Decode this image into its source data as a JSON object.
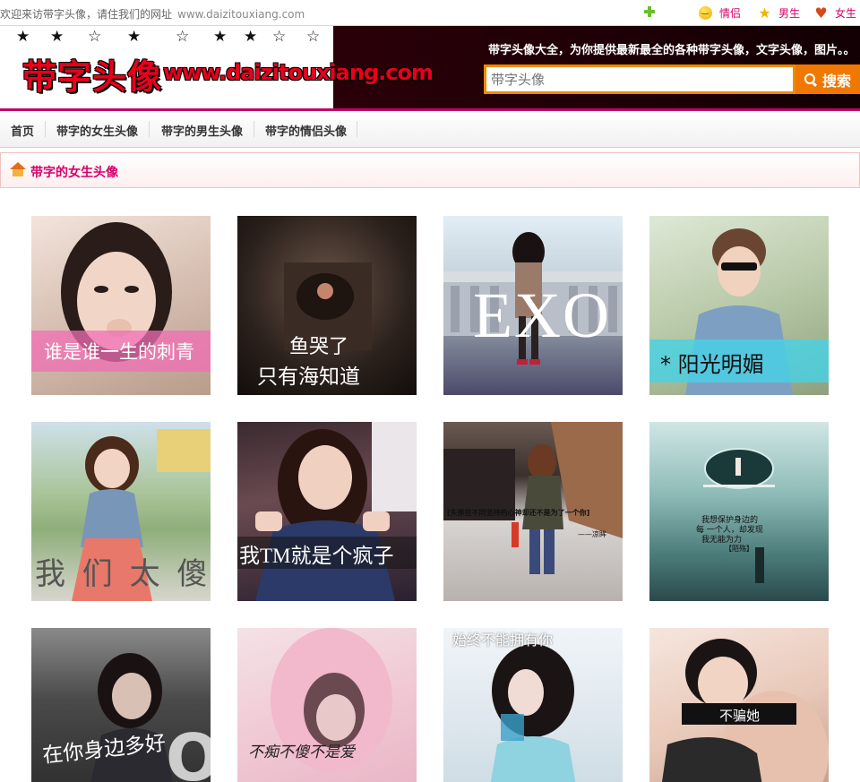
{
  "topbar": {
    "welcome": "欢迎来访带字头像，请住我们的网址",
    "url": "www.daizitouxiang.com",
    "links": [
      {
        "label": "情侣",
        "icon": "smile-icon"
      },
      {
        "label": "男生",
        "icon": "star-icon"
      },
      {
        "label": "女生",
        "icon": "heart-icon"
      }
    ]
  },
  "header": {
    "logo_cn": "带字头像",
    "logo_en": "www.daizitouxiang.com",
    "slogan": "带字头像大全，为你提供最新最全的各种带字头像，文字头像，图片。。",
    "search_placeholder": "带字头像",
    "search_button": "搜索"
  },
  "nav": {
    "items": [
      "首页",
      "带字的女生头像",
      "带字的男生头像",
      "带字的情侣头像"
    ]
  },
  "breadcrumb": {
    "title": "带字的女生头像"
  },
  "gallery": [
    {
      "caption": "谁是谁一生的刺青"
    },
    {
      "caption": "鱼哭了",
      "caption2": "只有海知道"
    },
    {
      "caption": "EXO"
    },
    {
      "caption": "* 阳光明媚"
    },
    {
      "caption": "我 们 太 傻"
    },
    {
      "caption": "我TM就是个疯子"
    },
    {
      "caption": "[失那些不同坚持的心神却还不是为了一个你]",
      "caption2": "——凉眸"
    },
    {
      "caption": "我想保护身边的",
      "caption2": "每 一个人，却发现",
      "caption3": "我无能为力",
      "caption4": "【陌殇】"
    },
    {
      "caption": "在你身边多好"
    },
    {
      "caption": "不痴不傻不是爱"
    },
    {
      "caption": "始终不能拥有你"
    },
    {
      "caption": "不骗她"
    }
  ]
}
